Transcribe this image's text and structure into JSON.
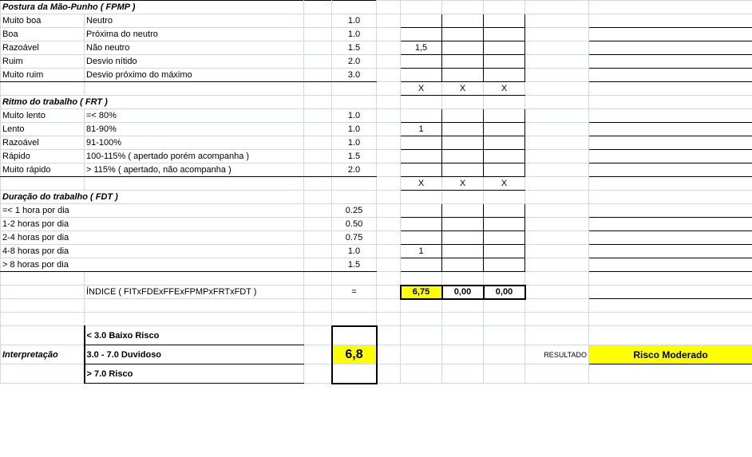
{
  "sections": {
    "fpmp": {
      "header": "Postura da Mão-Punho   ( FPMP )",
      "rows": [
        {
          "label": "Muito boa",
          "desc": "Neutro",
          "val": "1.0"
        },
        {
          "label": "Boa",
          "desc": "Próxima do neutro",
          "val": "1.0"
        },
        {
          "label": "Razoável",
          "desc": "Não neutro",
          "val": "1.5"
        },
        {
          "label": "Ruim",
          "desc": "Desvio nítido",
          "val": "2.0"
        },
        {
          "label": "Muito ruim",
          "desc": "Desvio próximo do máximo",
          "val": "3.0"
        }
      ],
      "input_val": "1,5",
      "x_row": [
        "X",
        "X",
        "X"
      ]
    },
    "frt": {
      "header": "Ritmo do trabalho   ( FRT )",
      "rows": [
        {
          "label": "Muito lento",
          "desc": "=< 80%",
          "val": "1.0"
        },
        {
          "label": "Lento",
          "desc": "81-90%",
          "val": "1.0"
        },
        {
          "label": "Razoável",
          "desc": "91-100%",
          "val": "1.0"
        },
        {
          "label": "Rápido",
          "desc": "100-115% ( apertado porém acompanha )",
          "val": "1.5"
        },
        {
          "label": "Muito rápido",
          "desc": " > 115% ( apertado, não acompanha )",
          "val": "2.0"
        }
      ],
      "input_val": "1",
      "x_row": [
        "X",
        "X",
        "X"
      ]
    },
    "fdt": {
      "header": "Duração do trabalho  ( FDT )",
      "rows": [
        {
          "label": " =< 1 hora por dia",
          "val": "0.25"
        },
        {
          "label": "1-2 horas por dia",
          "val": "0.50"
        },
        {
          "label": "2-4 horas por dia",
          "val": "0.75"
        },
        {
          "label": "4-8 horas por dia",
          "val": "1.0"
        },
        {
          "label": " > 8 horas por dia",
          "val": "1.5"
        }
      ],
      "input_val": "1"
    }
  },
  "index": {
    "label": "ÍNDICE  ( FITxFDExFFExFPMPxFRTxFDT )",
    "eq": "=",
    "vals": [
      "6,75",
      "0,00",
      "0,00"
    ]
  },
  "interpretation": {
    "label": "Interpretação",
    "rows": [
      {
        "range": "< 3.0   Baixo Risco"
      },
      {
        "range": "3.0 - 7.0   Duvidoso"
      },
      {
        "range": "> 7.0    Risco"
      }
    ],
    "value": "6,8",
    "result_label": "RESULTADO",
    "result": "Risco Moderado"
  },
  "chart_data": {
    "type": "table",
    "title": "Strain Index Worksheet Fragment",
    "factors": [
      {
        "factor": "FPMP",
        "selected": 1.5
      },
      {
        "factor": "FRT",
        "selected": 1
      },
      {
        "factor": "FDT",
        "selected": 1
      }
    ],
    "index_results": [
      6.75,
      0.0,
      0.0
    ],
    "overall_index": 6.8,
    "classification": "Risco Moderado",
    "thresholds": [
      {
        "range": "< 3.0",
        "label": "Baixo Risco"
      },
      {
        "range": "3.0 - 7.0",
        "label": "Duvidoso"
      },
      {
        "range": "> 7.0",
        "label": "Risco"
      }
    ]
  }
}
